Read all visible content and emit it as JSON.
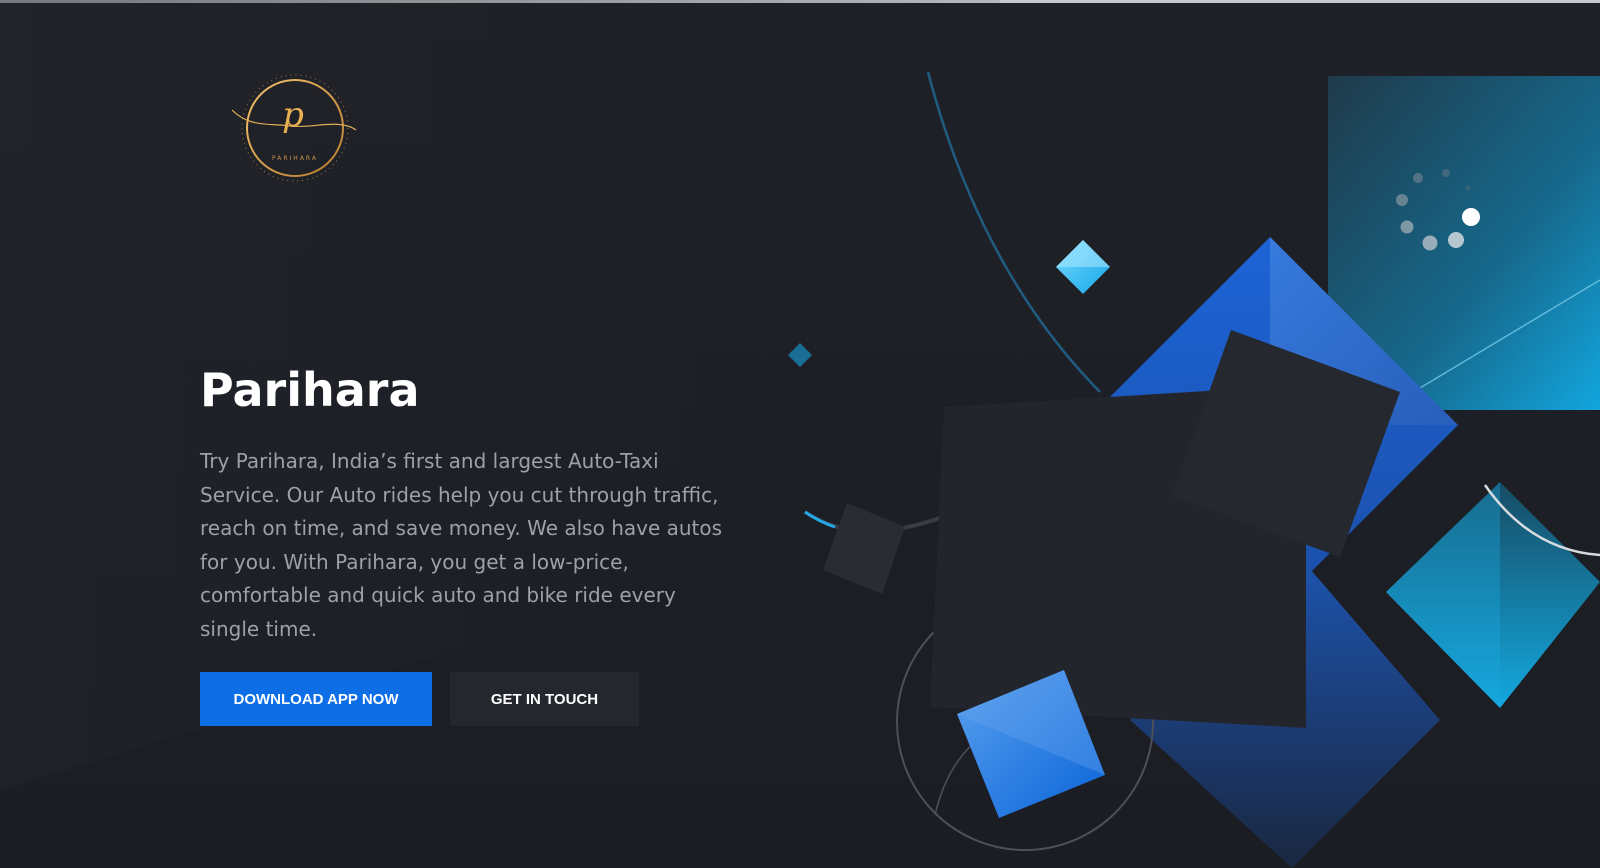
{
  "brand": {
    "logo_text": "PARIHARA",
    "logo_monogram": "p",
    "logo_color": "#d9a04a"
  },
  "hero": {
    "title": "Parihara",
    "description": "Try Parihara, India’s first and largest Auto-Taxi Service. Our Auto rides help you cut through traffic, reach on time, and save money. We also have autos for you. With Parihara, you get a low-price, comfortable and quick auto and bike ride every single time."
  },
  "actions": {
    "download_label": "DOWNLOAD APP NOW",
    "contact_label": "GET IN TOUCH"
  },
  "colors": {
    "background": "#1d1f26",
    "primary_button": "#0d6ee6",
    "secondary_button": "#25272f",
    "accent_blue": "#1d6fe0",
    "accent_cyan": "#19b4ec"
  },
  "decorations": {
    "loading_indicator": "dots-spinner-icon"
  }
}
